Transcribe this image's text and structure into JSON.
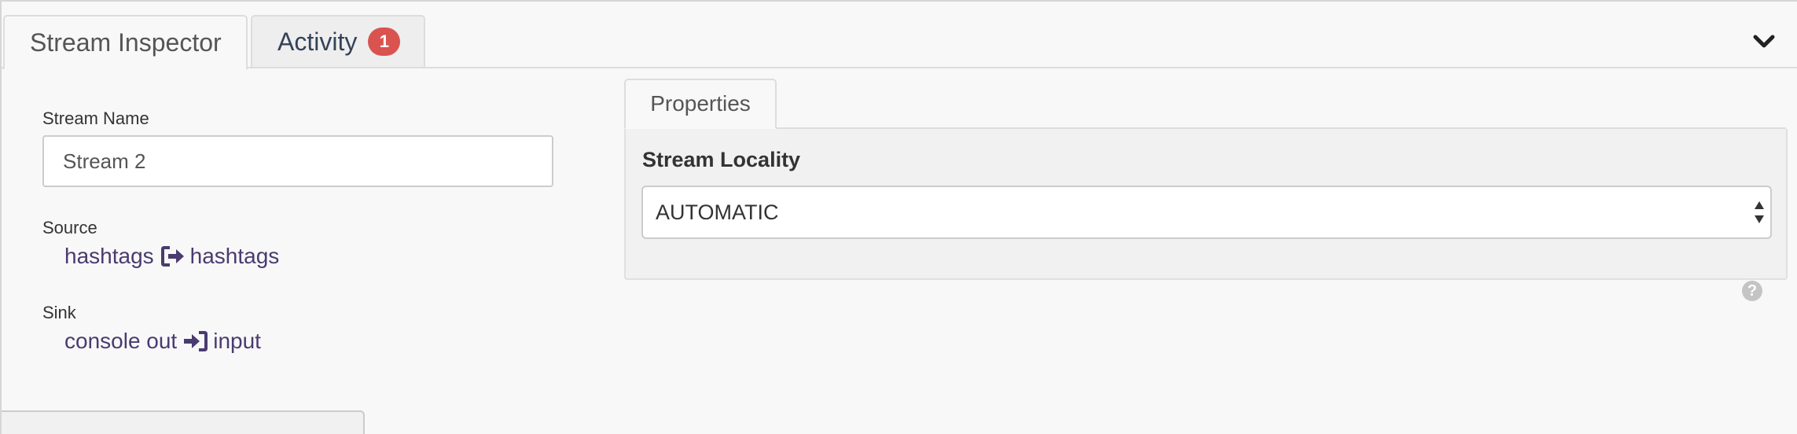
{
  "tabs": {
    "stream_inspector": "Stream Inspector",
    "activity": "Activity",
    "activity_badge": "1"
  },
  "collapse_icon": "chevron-down-icon",
  "form": {
    "stream_name_label": "Stream Name",
    "stream_name_value": "Stream 2",
    "source_label": "Source",
    "source": {
      "from": "hashtags",
      "icon": "sign-out-icon",
      "to": "hashtags"
    },
    "sink_label": "Sink",
    "sink": {
      "from": "console out",
      "icon": "sign-in-icon",
      "to": "input"
    }
  },
  "properties": {
    "tab_label": "Properties",
    "stream_locality_label": "Stream Locality",
    "help_icon": "question-circle-icon",
    "stream_locality_value": "AUTOMATIC"
  },
  "colors": {
    "link": "#4a3b70",
    "badge": "#d9534f",
    "border": "#dddddd",
    "panel_bg": "#f8f8f8"
  }
}
